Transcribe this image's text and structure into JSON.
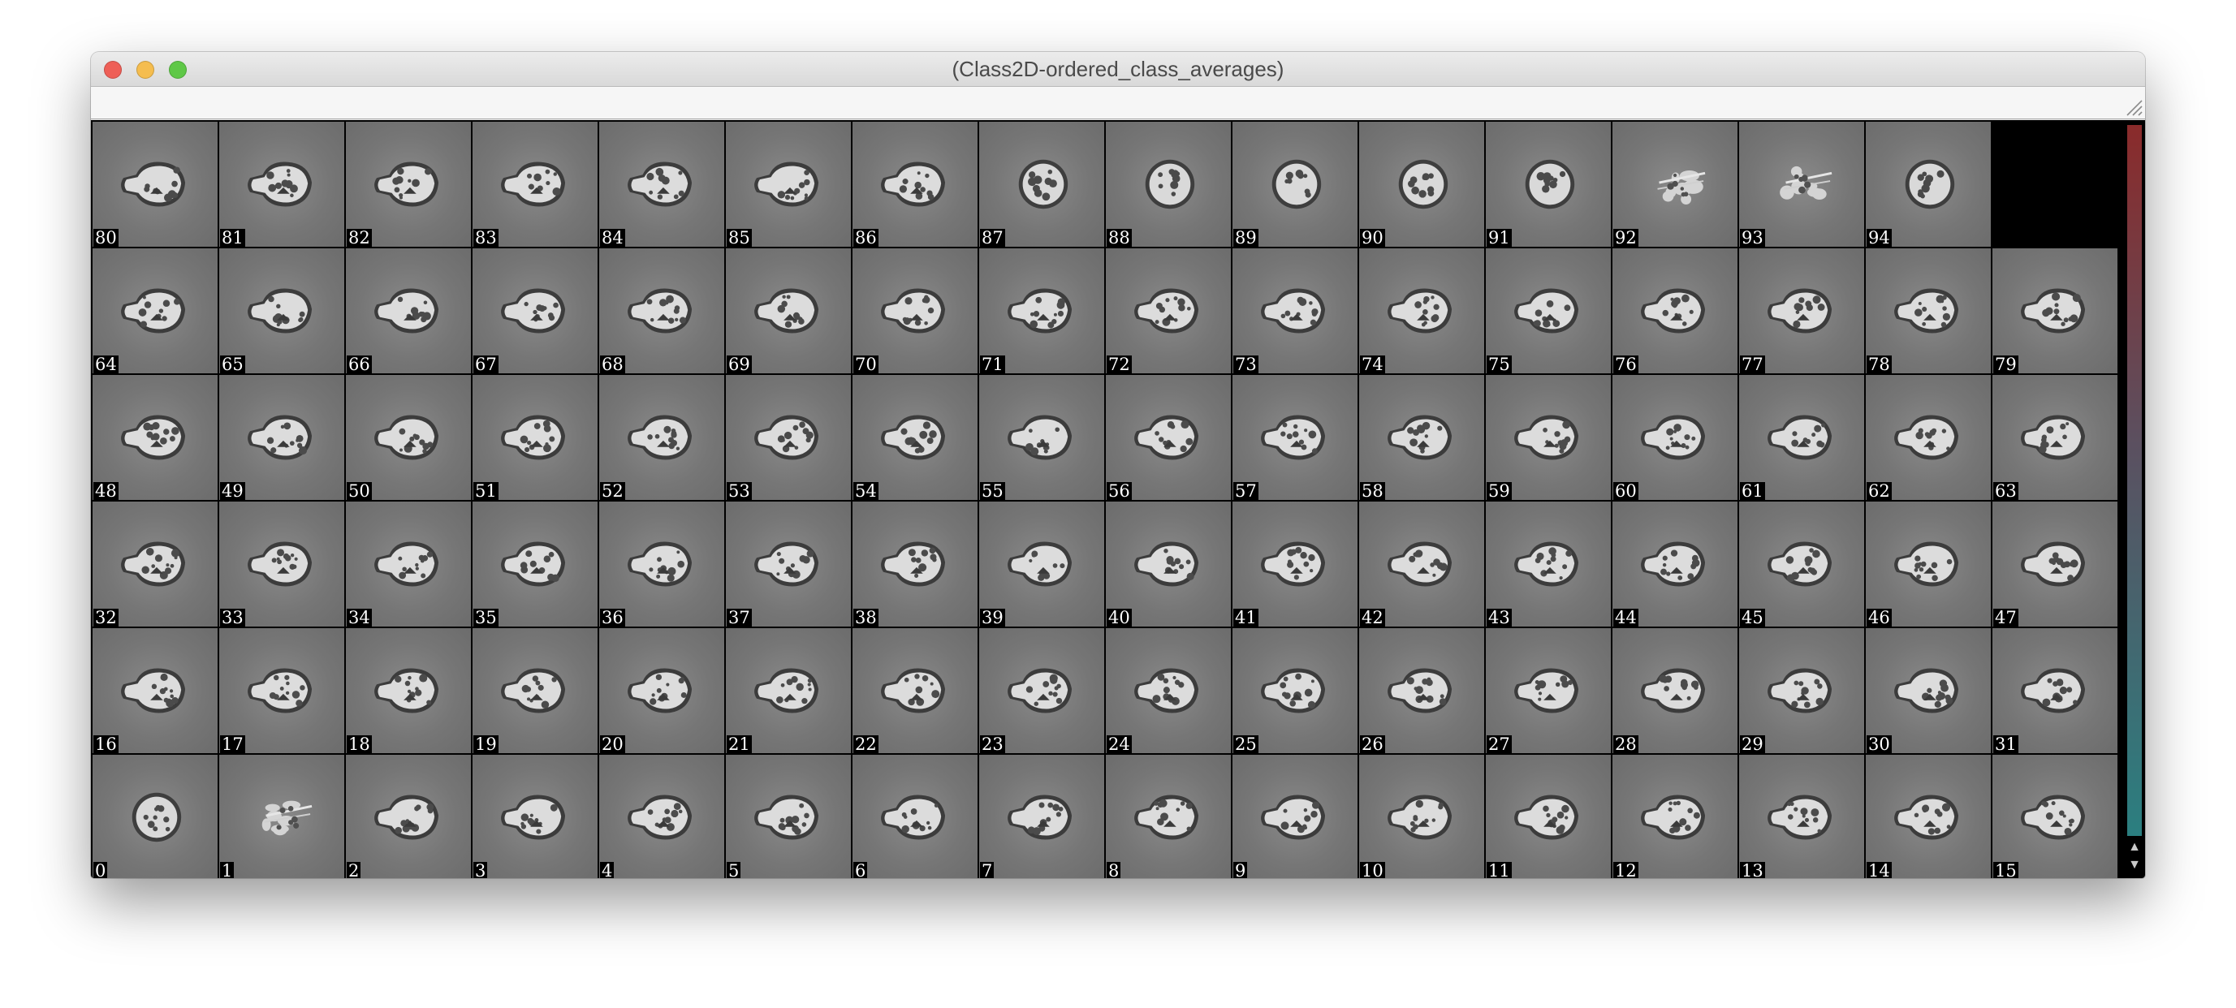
{
  "window": {
    "title": "(Class2D-ordered_class_averages)",
    "traffic_lights": {
      "close_color": "#ee5f57",
      "minimize_color": "#f5bd4f",
      "zoom_color": "#5fc847"
    }
  },
  "grid": {
    "columns": 16,
    "rows": [
      [
        "80",
        "81",
        "82",
        "83",
        "84",
        "85",
        "86",
        "87",
        "88",
        "89",
        "90",
        "91",
        "92",
        "93",
        "94"
      ],
      [
        "64",
        "65",
        "66",
        "67",
        "68",
        "69",
        "70",
        "71",
        "72",
        "73",
        "74",
        "75",
        "76",
        "77",
        "78",
        "79"
      ],
      [
        "48",
        "49",
        "50",
        "51",
        "52",
        "53",
        "54",
        "55",
        "56",
        "57",
        "58",
        "59",
        "60",
        "61",
        "62",
        "63"
      ],
      [
        "32",
        "33",
        "34",
        "35",
        "36",
        "37",
        "38",
        "39",
        "40",
        "41",
        "42",
        "43",
        "44",
        "45",
        "46",
        "47"
      ],
      [
        "16",
        "17",
        "18",
        "19",
        "20",
        "21",
        "22",
        "23",
        "24",
        "25",
        "26",
        "27",
        "28",
        "29",
        "30",
        "31"
      ],
      [
        "0",
        "1",
        "2",
        "3",
        "4",
        "5",
        "6",
        "7",
        "8",
        "9",
        "10",
        "11",
        "12",
        "13",
        "14",
        "15"
      ]
    ],
    "round_views": [
      "87",
      "88",
      "89",
      "90",
      "91",
      "94",
      "0"
    ],
    "irregular_views": [
      "92",
      "93",
      "1"
    ]
  },
  "scrollbar": {
    "up_icon": "triangle-up-icon",
    "down_icon": "triangle-down-icon",
    "gradient_colors": [
      "#8a2b2b",
      "#2b7f80"
    ]
  }
}
